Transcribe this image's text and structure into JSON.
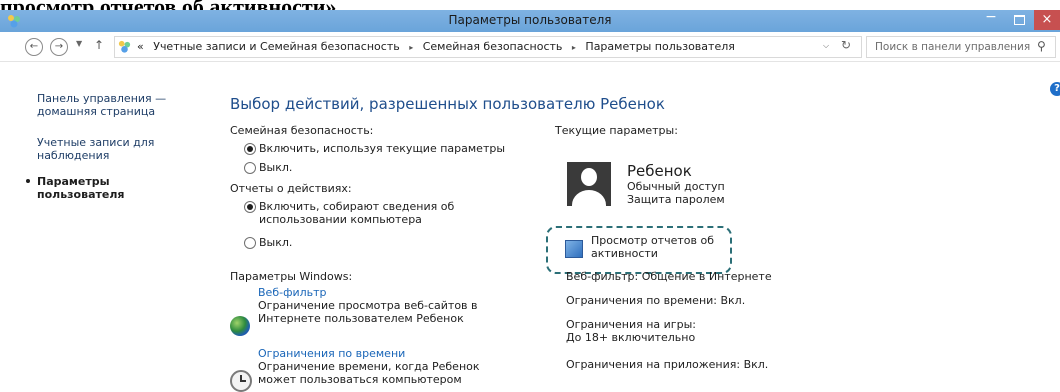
{
  "doc_heading": "просмотр отчетов об активности».",
  "window": {
    "title": "Параметры пользователя",
    "controls": {
      "minimize": "−",
      "maximize": "",
      "close": "×"
    }
  },
  "address_bar": {
    "back": "←",
    "forward": "→",
    "up": "↑",
    "breadcrumb_prefix": "«",
    "crumbs": [
      "Учетные записи и Семейная безопасность",
      "Семейная безопасность",
      "Параметры пользователя"
    ],
    "separator": "▸",
    "search_placeholder": "Поиск в панели управления"
  },
  "help": "?",
  "sidebar": {
    "items": [
      {
        "label": "Панель управления — домашняя страница"
      },
      {
        "label": "Учетные записи для наблюдения"
      },
      {
        "label": "Параметры пользователя",
        "active": true
      }
    ]
  },
  "main": {
    "title": "Выбор действий, разрешенных пользователю Ребенок",
    "family_safety": {
      "label": "Семейная безопасность:",
      "options": [
        "Включить, используя текущие параметры",
        "Выкл."
      ],
      "selected": 0
    },
    "activity_reports": {
      "label": "Отчеты о действиях:",
      "options": [
        "Включить, собирают сведения об использовании компьютера",
        "Выкл."
      ],
      "selected": 0
    },
    "windows_settings": {
      "label": "Параметры Windows:",
      "items": [
        {
          "icon": "globe-icon",
          "link": "Веб-фильтр",
          "desc": "Ограничение просмотра веб-сайтов в Интернете пользователем Ребенок"
        },
        {
          "icon": "clock-icon",
          "link": "Ограничения по времени",
          "desc": "Ограничение времени, когда Ребенок может пользоваться компьютером"
        }
      ]
    }
  },
  "current": {
    "label": "Текущие параметры:",
    "user": {
      "name": "Ребенок",
      "access": "Обычный доступ",
      "password": "Защита паролем"
    },
    "activity_link": "Просмотр отчетов об активности",
    "web_filter": "Веб-фильтр: Общение в Интернете",
    "time_limits": "Ограничения по времени: Вкл.",
    "game_limits_label": "Ограничения на игры:",
    "game_limits_value": "До 18+ включительно",
    "app_limits": "Ограничения на приложения: Вкл."
  },
  "colors": {
    "titlebar": "#6fa8dc",
    "link": "#1a66b8",
    "heading": "#1f4e8c",
    "close": "#c75050",
    "callout": "#2b6f77"
  }
}
